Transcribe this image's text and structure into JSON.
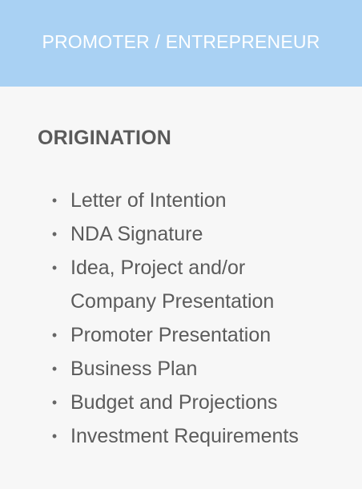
{
  "header": {
    "title": "PROMOTER / ENTREPRENEUR"
  },
  "section": {
    "title": "ORIGINATION",
    "items": [
      "Letter of Intention",
      "NDA Signature",
      "Idea, Project and/or Company Presentation",
      "Promoter Presentation",
      "Business Plan",
      "Budget and Projections",
      "Investment Requirements"
    ]
  },
  "colors": {
    "header_background": "#a9d1f3",
    "header_text": "#ffffff",
    "page_background": "#f7f7f7",
    "body_text": "#5b5b5b"
  }
}
